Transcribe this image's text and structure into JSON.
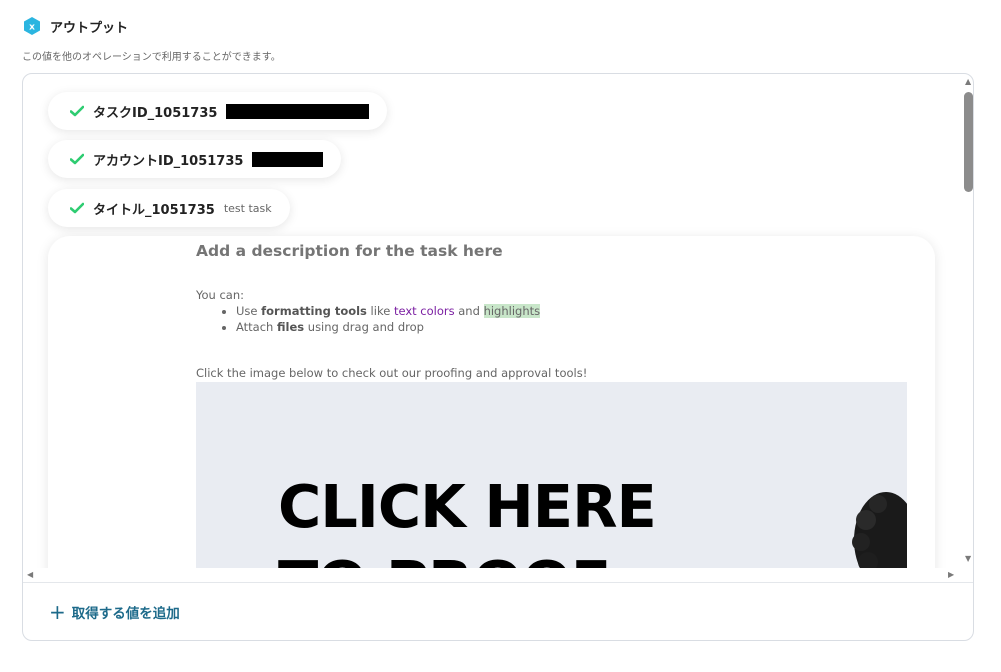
{
  "section": {
    "title": "アウトプット",
    "description": "この値を他のオペレーションで利用することができます。",
    "accent_color": "#2bb5e0"
  },
  "outputs": [
    {
      "key": "タスクID_1051735",
      "value": "",
      "redacted": true
    },
    {
      "key": "アカウントID_1051735",
      "value": "",
      "redacted": true
    },
    {
      "key": "タイトル_1051735",
      "value": "test task",
      "redacted": false
    }
  ],
  "description_card": {
    "heading": "Add a description for the task here",
    "intro": "You can:",
    "bullet1": {
      "pre": "Use ",
      "bold1": "formatting tools",
      "mid1": " like ",
      "purple": "text colors",
      "mid2": " and ",
      "highlight": "highlights"
    },
    "bullet2": {
      "pre": "Attach ",
      "bold": "files",
      "post": " using drag and drop"
    },
    "image_caption": "Click the image below to check out our proofing and approval tools!",
    "image_text_line1": "CLICK HERE",
    "image_text_line2": "TO PROOF"
  },
  "add_button": {
    "label": "取得する値を追加",
    "icon": "plus-icon",
    "color": "#1d6a8a"
  },
  "check_color": "#2ecc71"
}
